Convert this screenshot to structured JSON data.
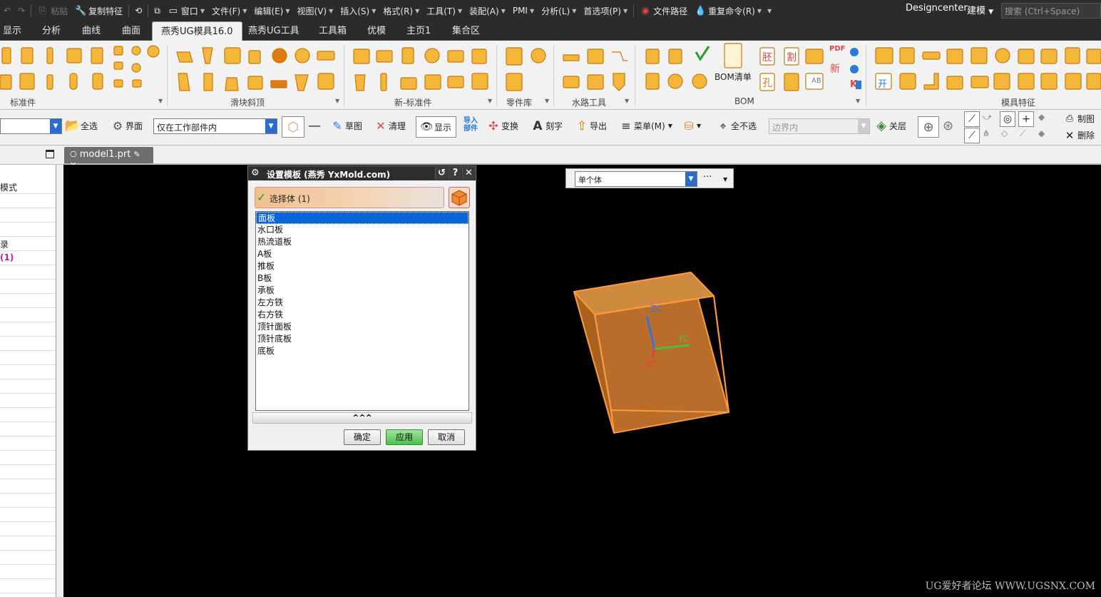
{
  "menubar": {
    "paste": "粘贴",
    "copy_feature": "复制特征",
    "window": "窗口",
    "file": "文件(F)",
    "edit": "编辑(E)",
    "view": "视图(V)",
    "insert": "插入(S)",
    "format": "格式(R)",
    "tools": "工具(T)",
    "assembly": "装配(A)",
    "pmi": "PMI",
    "analysis": "分析(L)",
    "preferences": "首选项(P)",
    "file_path": "文件路径",
    "repeat_cmd": "重复命令(R)",
    "designcenter": "Designcenter",
    "modeling": "建模",
    "search_placeholder": "搜索 (Ctrl+Space)"
  },
  "tabs": [
    "显示",
    "分析",
    "曲线",
    "曲面",
    "燕秀UG模具16.0",
    "燕秀UG工具",
    "工具箱",
    "优模",
    "主页1",
    "集合区"
  ],
  "active_tab": "燕秀UG模具16.0",
  "ribbon": {
    "groups": [
      "标准件",
      "滑块斜顶",
      "新-标准件",
      "零件库",
      "水路工具",
      "BOM",
      "模具特征"
    ],
    "bom_label": "BOM清单",
    "icon_texts": {
      "pdf": "PDF",
      "xin": "新",
      "pi": "胚",
      "ge": "割",
      "kai": "开",
      "kong": "孔",
      "ab": "AB",
      "k": "K"
    }
  },
  "toolbar2": {
    "select_all": "全选",
    "interface": "界面",
    "scope_value": "仅在工作部件内",
    "sketch": "草图",
    "clean": "清理",
    "display": "显示",
    "import_part": "导入部件",
    "transform": "变换",
    "engrave": "刻字",
    "export": "导出",
    "menu": "菜单(M)",
    "deselect_all": "全不选",
    "boundary_placeholder": "边界内",
    "close_layer": "关层",
    "drawing": "制图",
    "delete": "删除"
  },
  "nav": {
    "rows": [
      "模式",
      "",
      "",
      "",
      "录",
      "(1)",
      "",
      "",
      "",
      "",
      "",
      "",
      "",
      "",
      "",
      "",
      "",
      "",
      "",
      "",
      "",
      "",
      "",
      "",
      "",
      "",
      "",
      "",
      ""
    ]
  },
  "doc_tab": "model1.prt",
  "dialog": {
    "title": "设置模板  (燕秀 YxMold.com)",
    "select_label": "选择体 (1)",
    "items": [
      "面板",
      "水口板",
      "热流道板",
      "A板",
      "推板",
      "B板",
      "承板",
      "左方铁",
      "右方铁",
      "顶针面板",
      "顶针底板",
      "底板"
    ],
    "selected_index": 0,
    "ok": "确定",
    "apply": "应用",
    "cancel": "取消",
    "expander": "^^^"
  },
  "selection_filter": {
    "value": "单个体",
    "more": "···"
  },
  "axes": {
    "x": "XC",
    "y": "YC",
    "z": "ZC"
  },
  "watermark": "UG爱好者论坛 WWW.UGSNX.COM",
  "colors": {
    "icon_orange": "#f5a623",
    "icon_blue": "#2a7bd6",
    "block_fill": "#c27a32",
    "block_edge": "#ff9a3c",
    "select_blue": "#0a64d8"
  }
}
